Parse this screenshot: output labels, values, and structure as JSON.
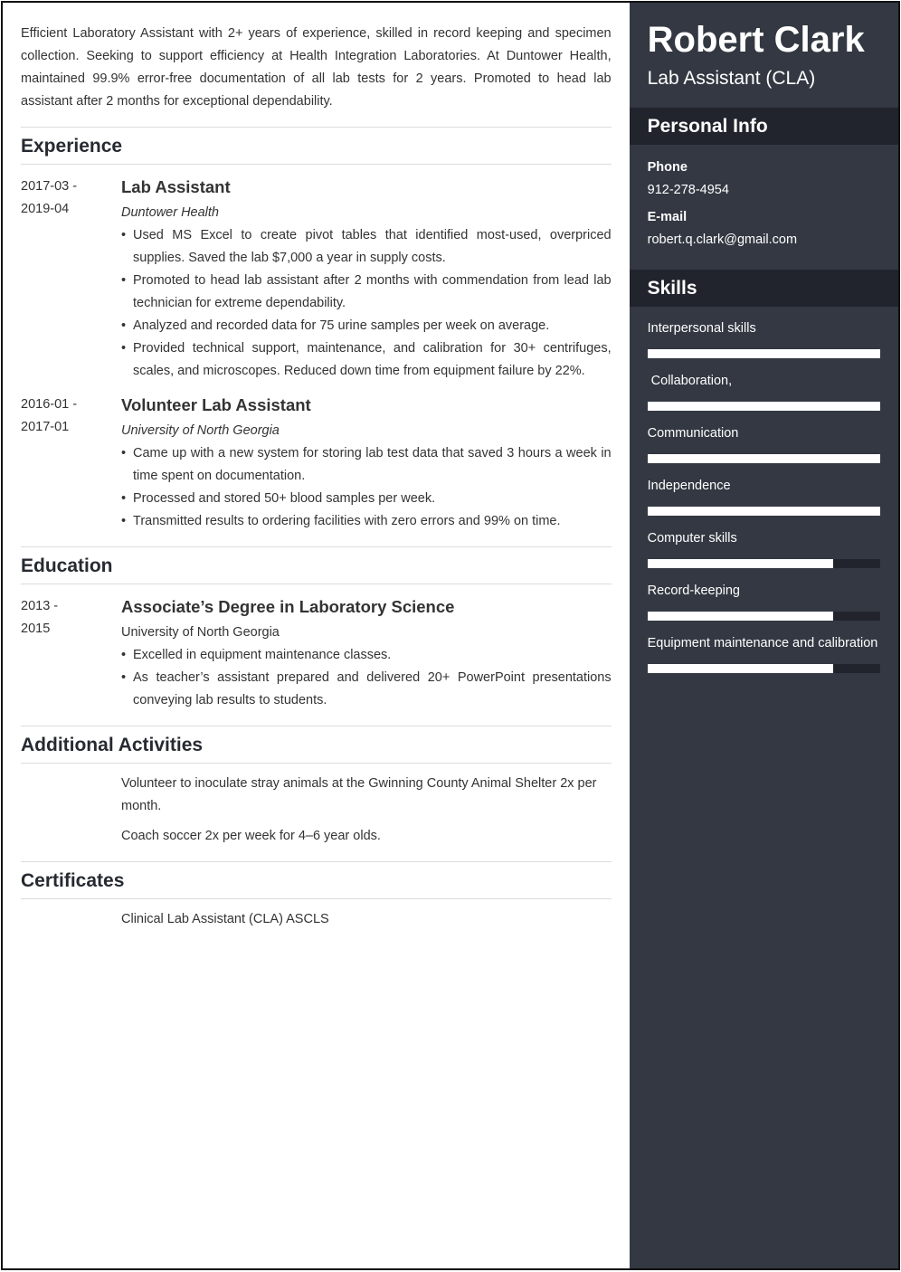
{
  "header": {
    "name": "Robert Clark",
    "role": "Lab Assistant (CLA)"
  },
  "summary": "Efficient Laboratory Assistant with 2+ years of experience, skilled in record keeping and specimen collection. Seeking to support efficiency at Health Integration Laboratories. At Duntower Health, maintained 99.9% error-free documentation of all lab tests for 2 years. Promoted to head lab assistant after 2 months for exceptional dependability.",
  "experience": {
    "title": "Experience",
    "entries": [
      {
        "date_start": "2017-03 -",
        "date_end": "2019-04",
        "title": "Lab Assistant",
        "org": "Duntower Health",
        "bullets": [
          "Used MS Excel to create pivot tables that identified most-used, overpriced supplies. Saved the lab $7,000 a year in supply costs.",
          "Promoted to head lab assistant after 2 months with commendation from lead lab technician for extreme dependability.",
          "Analyzed and recorded data for 75 urine samples per week on average.",
          "Provided technical support, maintenance, and calibration for 30+ centrifuges, scales, and microscopes. Reduced down time from equipment failure by 22%."
        ]
      },
      {
        "date_start": "2016-01 -",
        "date_end": "2017-01",
        "title": "Volunteer Lab Assistant",
        "org": "University of North Georgia",
        "bullets": [
          "Came up with a new system for storing lab test data that saved 3 hours a week in time spent on documentation.",
          "Processed and stored 50+ blood samples per week.",
          "Transmitted results to ordering facilities with zero errors and 99% on time."
        ]
      }
    ]
  },
  "education": {
    "title": "Education",
    "entries": [
      {
        "date_start": "2013 -",
        "date_end": "2015",
        "title": "Associate’s Degree in Laboratory Science",
        "org": "University of North Georgia",
        "bullets": [
          "Excelled in equipment maintenance classes.",
          "As teacher’s assistant prepared and delivered 20+ PowerPoint presentations conveying lab results to students."
        ]
      }
    ]
  },
  "activities": {
    "title": "Additional Activities",
    "items": [
      "Volunteer to inoculate stray animals at the Gwinning County Animal Shelter 2x per month.",
      "Coach soccer 2x per week for 4–6 year olds."
    ]
  },
  "certificates": {
    "title": "Certificates",
    "items": [
      "Clinical Lab Assistant (CLA) ASCLS"
    ]
  },
  "personal_info": {
    "title": "Personal Info",
    "phone_label": "Phone",
    "phone": "912-278-4954",
    "email_label": "E-mail",
    "email": "robert.q.clark@gmail.com"
  },
  "skills": {
    "title": "Skills",
    "items": [
      {
        "name": "Interpersonal skills",
        "level": 1.0
      },
      {
        "name": " Collaboration,",
        "level": 1.0
      },
      {
        "name": "Communication",
        "level": 1.0
      },
      {
        "name": "Independence",
        "level": 1.0
      },
      {
        "name": "Computer skills",
        "level": 0.8
      },
      {
        "name": "Record-keeping",
        "level": 0.8
      },
      {
        "name": "Equipment maintenance and calibration",
        "level": 0.8
      }
    ]
  },
  "colors": {
    "sidebar_bg": "#333842",
    "sidebar_header_bg": "#21242c",
    "text": "#333333",
    "skill_fill": "#ffffff"
  }
}
